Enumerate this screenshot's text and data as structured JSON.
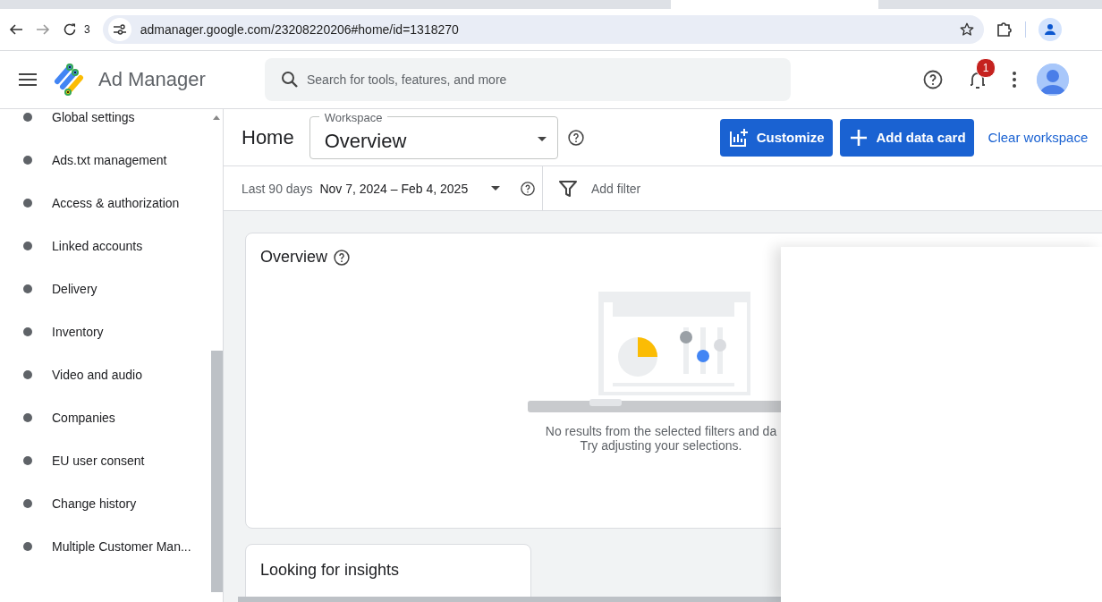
{
  "browser": {
    "toolbar_text": "3",
    "url": "admanager.google.com/23208220206#home/id=1318270"
  },
  "app": {
    "title": "Ad Manager",
    "search": {
      "placeholder": "Search for tools, features, and more"
    },
    "notification_count": "1"
  },
  "sidebar": {
    "items": [
      {
        "label": "Global settings"
      },
      {
        "label": "Ads.txt management"
      },
      {
        "label": "Access & authorization"
      },
      {
        "label": "Linked accounts"
      },
      {
        "label": "Delivery"
      },
      {
        "label": "Inventory"
      },
      {
        "label": "Video and audio"
      },
      {
        "label": "Companies"
      },
      {
        "label": "EU user consent"
      },
      {
        "label": "Change history"
      },
      {
        "label": "Multiple Customer Man..."
      }
    ]
  },
  "page": {
    "title": "Home",
    "workspace": {
      "label": "Workspace",
      "value": "Overview"
    },
    "buttons": [
      {
        "label": "Customize",
        "kind": "customize"
      },
      {
        "label": "Add data card",
        "kind": "add"
      }
    ],
    "link": "Clear workspace"
  },
  "filters": {
    "range_label": "Last 90 days",
    "range": "Nov 7, 2024 – Feb 4, 2025",
    "add_filter": "Add filter"
  },
  "cards": [
    {
      "title": "Overview",
      "empty_message": [
        "No results from the selected filters and da",
        "Try adjusting your selections."
      ]
    },
    {
      "title": "Looking for insights"
    }
  ]
}
